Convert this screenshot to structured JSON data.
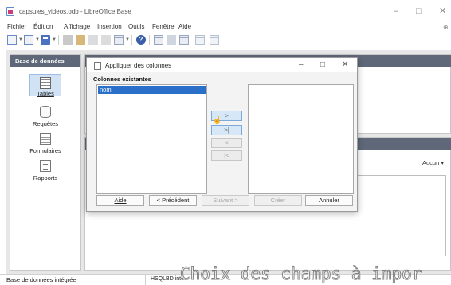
{
  "window": {
    "title": "capsules_videos.odb - LibreOffice Base",
    "minimize_glyph": "–",
    "maximize_glyph": "□",
    "close_glyph": "✕"
  },
  "menu": {
    "items": [
      "Fichier",
      "Édition",
      "Affichage",
      "Insertion",
      "Outils",
      "Fenêtre",
      "Aide"
    ],
    "help_glyph": "⊕"
  },
  "sidebar": {
    "header": "Base de données",
    "items": [
      {
        "label": "Tables",
        "icon": "table-icon"
      },
      {
        "label": "Requêtes",
        "icon": "query-icon"
      },
      {
        "label": "Formulaires",
        "icon": "form-icon"
      },
      {
        "label": "Rapports",
        "icon": "report-icon"
      }
    ],
    "active": "Tables"
  },
  "preview": {
    "select_value": "Aucun",
    "select_arrow": "▾"
  },
  "dialog": {
    "title": "Appliquer des colonnes",
    "section_label": "Colonnes existantes",
    "existing_columns": [
      "nom"
    ],
    "move_buttons": [
      ">",
      ">|",
      "<",
      "|<"
    ],
    "buttons": {
      "help": "Aide",
      "previous": "< Précédent",
      "next": "Suivant >",
      "create": "Créer",
      "cancel": "Annuler"
    },
    "minimize_glyph": "–",
    "maximize_glyph": "□",
    "close_glyph": "✕"
  },
  "status": {
    "left": "Base de données intégrée",
    "right": "HSQLBD inté"
  },
  "caption": "Choix des champs à impor"
}
